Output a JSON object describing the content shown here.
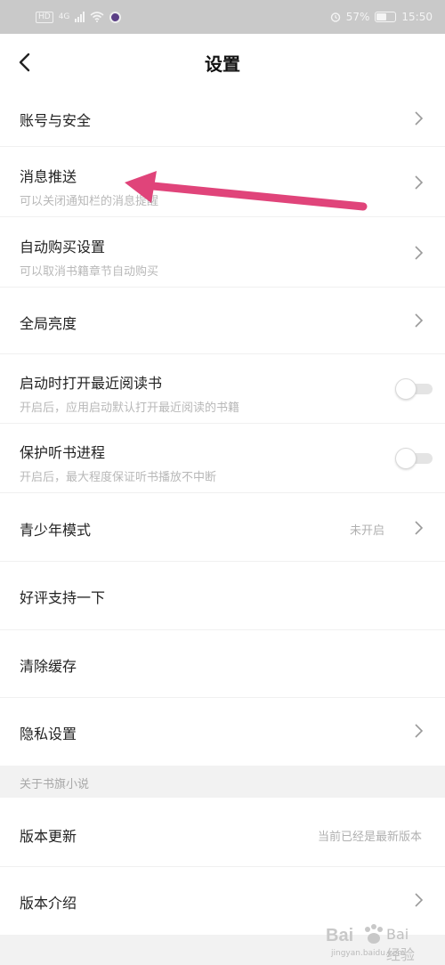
{
  "status_bar": {
    "left_badge": "HD",
    "network": "4G",
    "battery": "57%",
    "time": "15:50",
    "icons": [
      "sim-hd-icon",
      "signal-icon",
      "wifi-icon",
      "app-notification-icon",
      "alarm-icon",
      "battery-icon"
    ]
  },
  "nav": {
    "title": "设置",
    "back_icon": "chevron-left-icon"
  },
  "settings": [
    {
      "title": "账号与安全",
      "subtitle": "",
      "control": "chevron"
    },
    {
      "title": "消息推送",
      "subtitle": "可以关闭通知栏的消息提醒",
      "control": "chevron"
    },
    {
      "title": "自动购买设置",
      "subtitle": "可以取消书籍章节自动购买",
      "control": "chevron"
    },
    {
      "title": "全局亮度",
      "subtitle": "",
      "control": "chevron"
    },
    {
      "title": "启动时打开最近阅读书",
      "subtitle": "开启后，应用启动默认打开最近阅读的书籍",
      "control": "toggle",
      "on": false
    },
    {
      "title": "保护听书进程",
      "subtitle": "开启后，最大程度保证听书播放不中断",
      "control": "toggle",
      "on": false
    },
    {
      "title": "青少年模式",
      "value": "未开启",
      "control": "chevron"
    },
    {
      "title": "好评支持一下",
      "subtitle": "",
      "control": "none"
    },
    {
      "title": "清除缓存",
      "subtitle": "",
      "control": "none"
    },
    {
      "title": "隐私设置",
      "subtitle": "",
      "control": "chevron"
    }
  ],
  "section_about": {
    "header": "关于书旗小说"
  },
  "about": [
    {
      "title": "版本更新",
      "value": "当前已经是最新版本",
      "control": "none"
    },
    {
      "title": "版本介绍",
      "control": "chevron"
    }
  ],
  "annotation": {
    "arrow_color": "#e0447a",
    "points_to": "消息推送"
  },
  "watermark": {
    "text": "Bai 经验",
    "caption": "jingyan.baidu.com"
  },
  "colors": {
    "status_bar_bg": "#c9c9c9",
    "page_bg": "#f2f2f2",
    "text_primary": "#222222",
    "text_secondary": "#b8b8b8"
  }
}
